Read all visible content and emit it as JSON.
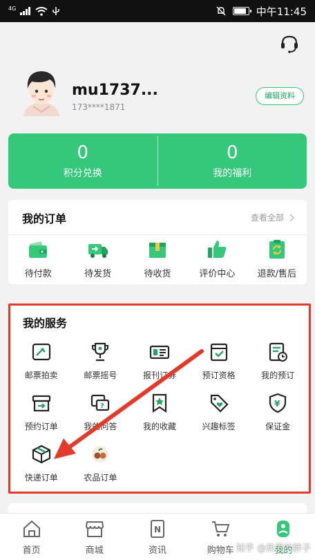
{
  "status_bar": {
    "network": "4G",
    "time": "中午11:45",
    "battery_level": 0.85
  },
  "header": {
    "username": "mu1737...",
    "phone": "173****1871",
    "edit_profile_label": "编辑资料"
  },
  "points_card": {
    "points": {
      "value": "0",
      "label": "积分兑换"
    },
    "welfare": {
      "value": "0",
      "label": "我的福利"
    }
  },
  "orders": {
    "title": "我的订单",
    "see_all": "查看全部",
    "items": [
      {
        "label": "待付款",
        "icon": "wallet-icon"
      },
      {
        "label": "待发货",
        "icon": "truck-icon"
      },
      {
        "label": "待收货",
        "icon": "package-icon"
      },
      {
        "label": "评价中心",
        "icon": "thumbs-up-icon"
      },
      {
        "label": "退款/售后",
        "icon": "refund-icon"
      }
    ]
  },
  "services": {
    "title": "我的服务",
    "items": [
      {
        "label": "邮票拍卖",
        "icon": "stamp-auction-icon"
      },
      {
        "label": "邮票摇号",
        "icon": "trophy-icon"
      },
      {
        "label": "报刊订券",
        "icon": "coupon-icon"
      },
      {
        "label": "预订资格",
        "icon": "booking-box-icon"
      },
      {
        "label": "我的预订",
        "icon": "reservation-list-icon"
      },
      {
        "label": "预约订单",
        "icon": "appointment-order-icon"
      },
      {
        "label": "我的问答",
        "icon": "qa-icon"
      },
      {
        "label": "我的收藏",
        "icon": "star-bookmark-icon"
      },
      {
        "label": "兴趣标签",
        "icon": "tag-heart-icon"
      },
      {
        "label": "保证金",
        "icon": "deposit-shield-icon"
      },
      {
        "label": "快递订单",
        "icon": "express-box-icon"
      },
      {
        "label": "农品订单",
        "icon": "farm-product-icon"
      }
    ]
  },
  "bottom_nav": {
    "items": [
      {
        "label": "首页",
        "icon": "home-icon"
      },
      {
        "label": "商城",
        "icon": "store-icon"
      },
      {
        "label": "资讯",
        "icon": "news-icon"
      },
      {
        "label": "购物车",
        "icon": "cart-icon"
      },
      {
        "label": "我的",
        "icon": "profile-icon",
        "active": true
      }
    ]
  },
  "watermark": "知乎 @热爱的胖子",
  "colors": {
    "accent": "#34c97a",
    "highlight_border": "#e23b2a",
    "arrow": "#e23b2a"
  }
}
